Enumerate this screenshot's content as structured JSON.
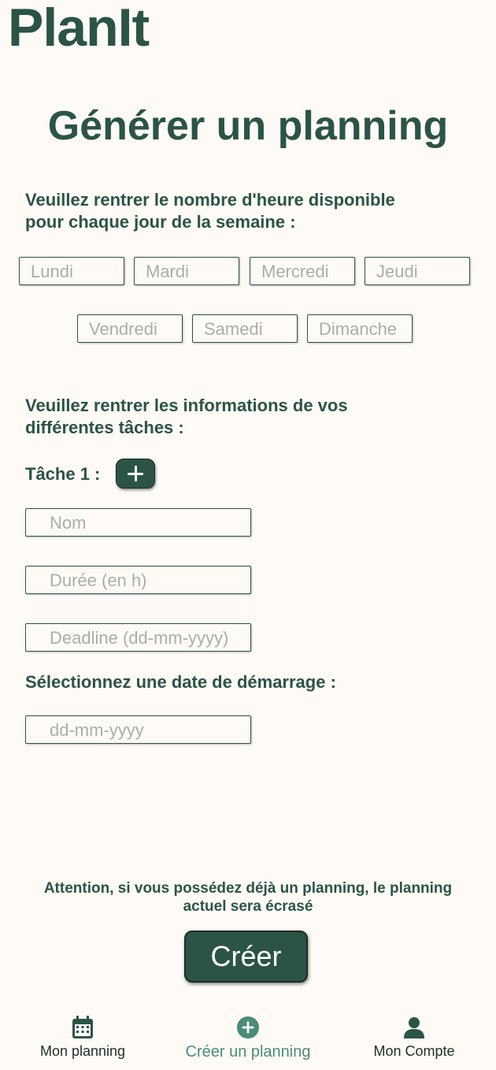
{
  "app": {
    "logo": "PlanIt"
  },
  "page": {
    "title": "Générer un planning"
  },
  "availability": {
    "label_line1": "Veuillez rentrer le nombre d'heure disponible",
    "label_line2": "pour chaque jour de la semaine :",
    "days": [
      {
        "placeholder": "Lundi",
        "value": ""
      },
      {
        "placeholder": "Mardi",
        "value": ""
      },
      {
        "placeholder": "Mercredi",
        "value": ""
      },
      {
        "placeholder": "Jeudi",
        "value": ""
      },
      {
        "placeholder": "Vendredi",
        "value": ""
      },
      {
        "placeholder": "Samedi",
        "value": ""
      },
      {
        "placeholder": "Dimanche",
        "value": ""
      }
    ]
  },
  "tasks": {
    "label_line1": "Veuillez rentrer les informations de vos",
    "label_line2": "différentes tâches :",
    "task_label": "Tâche 1 :",
    "add_icon": "plus-icon",
    "name_placeholder": "Nom",
    "duration_placeholder": "Durée (en h)",
    "deadline_placeholder": "Deadline (dd-mm-yyyy)"
  },
  "start_date": {
    "label": "Sélectionnez une date de démarrage :",
    "placeholder": "dd-mm-yyyy"
  },
  "warning": {
    "line1": "Attention, si vous possédez déjà un planning, le planning",
    "line2": "actuel sera écrasé"
  },
  "actions": {
    "create_label": "Créer"
  },
  "bottom_nav": {
    "items": [
      {
        "label": "Mon planning",
        "icon": "calendar-icon",
        "active": false
      },
      {
        "label": "Créer un planning",
        "icon": "plus-circle-icon",
        "active": true
      },
      {
        "label": "Mon Compte",
        "icon": "user-icon",
        "active": false
      }
    ]
  },
  "colors": {
    "primary": "#2b5447",
    "accent": "#4a8c79",
    "background": "#fefaf5",
    "placeholder": "#a7afaa"
  }
}
